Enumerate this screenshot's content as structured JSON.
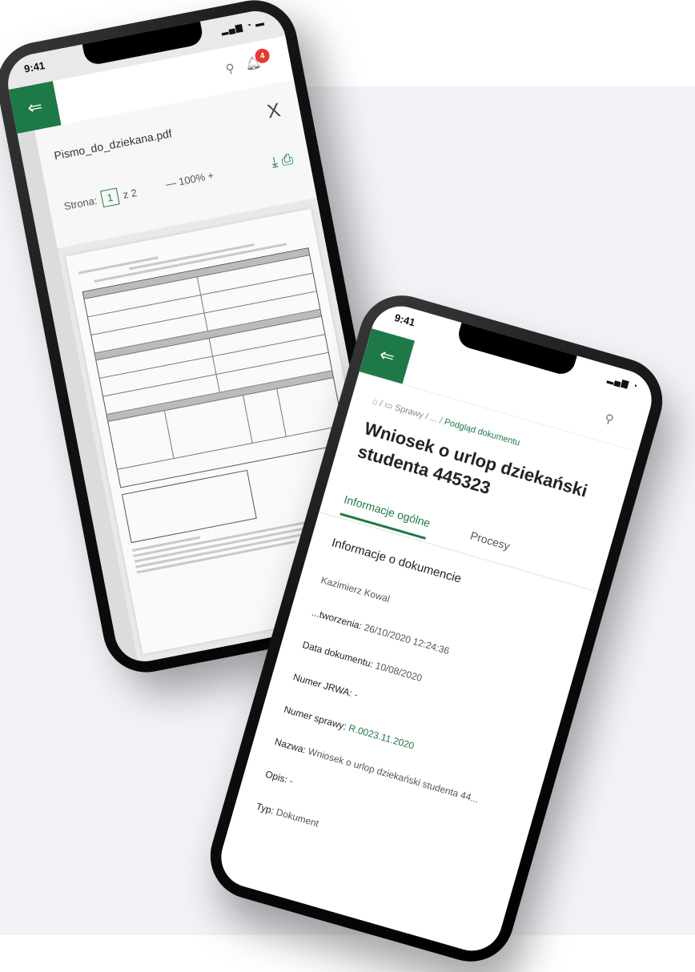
{
  "status": {
    "time": "9:41"
  },
  "appbar": {
    "notification_count": "4"
  },
  "pdf_viewer": {
    "file_name": "Pismo_do_dziekana.pdf",
    "close_label": "X",
    "page_label": "Strona:",
    "page_current": "1",
    "page_total": "z 2",
    "zoom": "— 100% +"
  },
  "details": {
    "breadcrumb_prefix": "⌂ / ▭ Sprawy / ... /",
    "breadcrumb_current": "Podgląd dokumentu",
    "title": "Wniosek o urlop dziekański studenta 445323",
    "tabs": [
      "Informacje ogólne",
      "Procesy"
    ],
    "section_title": "Informacje o dokumencie",
    "fields": [
      {
        "label": "",
        "value": "Kazimierz Kowal",
        "link": false
      },
      {
        "label": "...tworzenia:",
        "value": "26/10/2020 12:24:36",
        "link": false
      },
      {
        "label": "Data dokumentu:",
        "value": "10/08/2020",
        "link": false
      },
      {
        "label": "Numer JRWA:",
        "value": "-",
        "link": false
      },
      {
        "label": "Numer sprawy:",
        "value": "R.0023.11.2020",
        "link": true
      },
      {
        "label": "Nazwa:",
        "value": "Wniosek o urlop dziekański studenta 44...",
        "link": false
      },
      {
        "label": "Opis:",
        "value": "-",
        "link": false
      },
      {
        "label": "Typ:",
        "value": "Dokument",
        "link": false
      }
    ]
  },
  "colors": {
    "accent": "#1d7a46",
    "badge": "#e53935"
  }
}
